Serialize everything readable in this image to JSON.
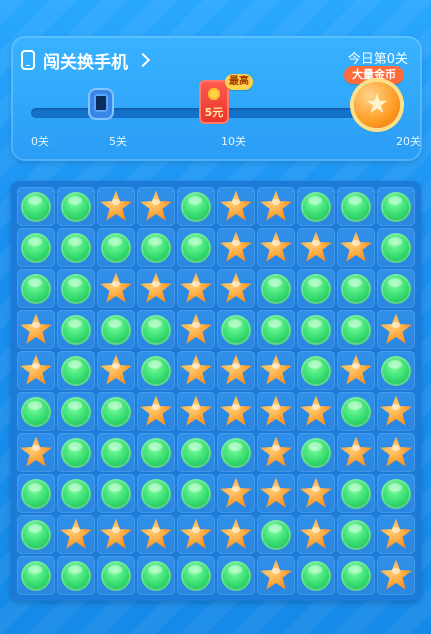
{
  "header": {
    "title": "闯关换手机",
    "today_level": "今日第0关",
    "reward_badge": "大量金币",
    "highest_tag": "最高",
    "redpack_amount": "5元",
    "progress_ticks": [
      "0关",
      "5关",
      "10关",
      "20关"
    ]
  },
  "board": {
    "rows": [
      [
        "clover",
        "clover",
        "star",
        "star",
        "clover",
        "star",
        "star",
        "clover",
        "clover",
        "clover"
      ],
      [
        "clover",
        "clover",
        "clover",
        "clover",
        "clover",
        "star",
        "star",
        "star",
        "star",
        "clover"
      ],
      [
        "clover",
        "clover",
        "star",
        "star",
        "star",
        "star",
        "clover",
        "clover",
        "clover",
        "clover"
      ],
      [
        "star",
        "clover",
        "clover",
        "clover",
        "star",
        "clover",
        "clover",
        "clover",
        "clover",
        "star"
      ],
      [
        "star",
        "clover",
        "star",
        "clover",
        "star",
        "star",
        "star",
        "clover",
        "star",
        "clover"
      ],
      [
        "clover",
        "clover",
        "clover",
        "star",
        "star",
        "star",
        "star",
        "star",
        "clover",
        "star"
      ],
      [
        "star",
        "clover",
        "clover",
        "clover",
        "clover",
        "clover",
        "star",
        "clover",
        "star",
        "star"
      ],
      [
        "clover",
        "clover",
        "clover",
        "clover",
        "clover",
        "star",
        "star",
        "star",
        "clover",
        "clover"
      ],
      [
        "clover",
        "star",
        "star",
        "star",
        "star",
        "star",
        "clover",
        "star",
        "clover",
        "star"
      ],
      [
        "clover",
        "clover",
        "clover",
        "clover",
        "clover",
        "clover",
        "star",
        "clover",
        "clover",
        "star"
      ]
    ]
  }
}
